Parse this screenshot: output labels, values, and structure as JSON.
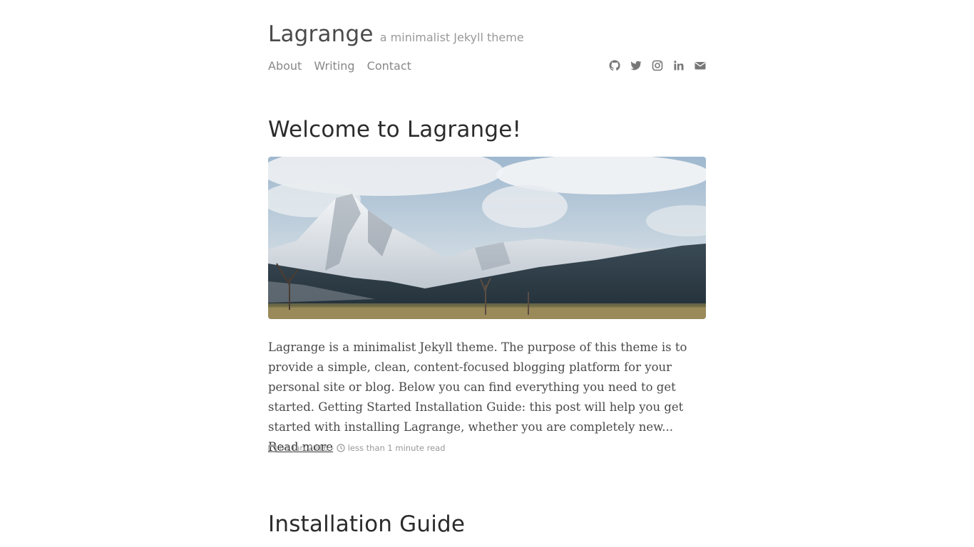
{
  "site": {
    "title": "Lagrange",
    "description": "a minimalist Jekyll theme"
  },
  "nav": {
    "items": [
      {
        "label": "About"
      },
      {
        "label": "Writing"
      },
      {
        "label": "Contact"
      }
    ]
  },
  "social": {
    "icons": [
      "github-icon",
      "twitter-icon",
      "instagram-icon",
      "linkedin-icon",
      "envelope-icon"
    ]
  },
  "posts": [
    {
      "title": "Welcome to Lagrange!",
      "excerpt": "Lagrange is a minimalist Jekyll theme. The purpose of this theme is to provide a simple, clean, content-focused blogging platform for your personal site or blog. Below you can find everything you need to get started. Getting Started Installation Guide: this post will help you get started with installing Lagrange, whether you are completely new...",
      "read_more": "Read more",
      "date": "01 Jan 2016",
      "separator": "-",
      "read_time": "less than 1 minute read"
    },
    {
      "title": "Installation Guide"
    }
  ],
  "colors": {
    "text": "#333333",
    "muted": "#999999",
    "nav": "#888888"
  }
}
